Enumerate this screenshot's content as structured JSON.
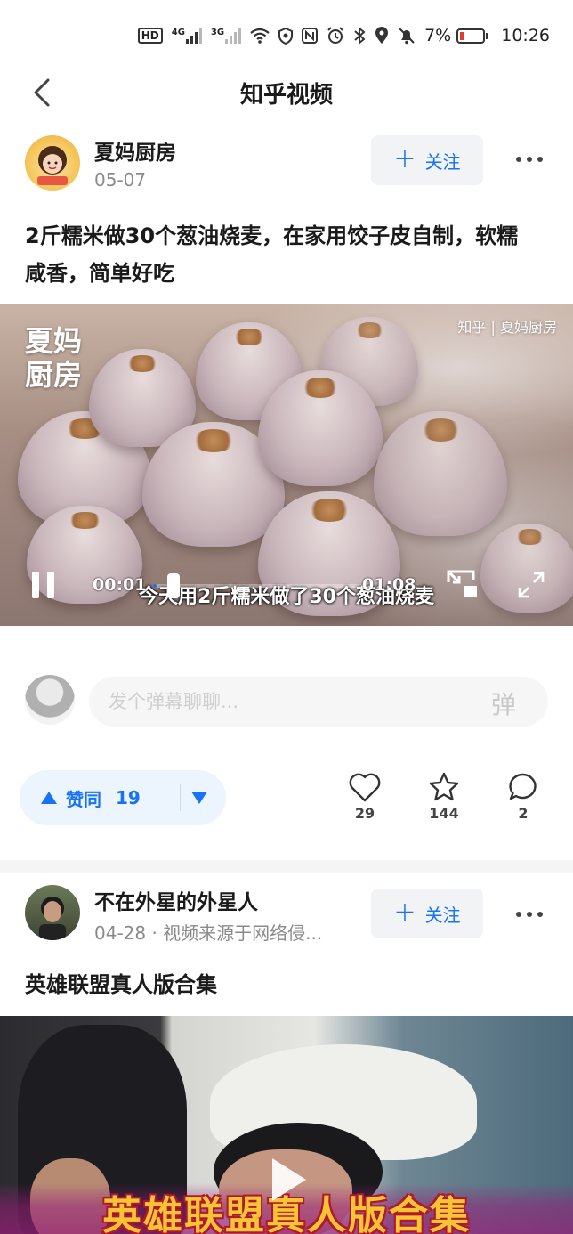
{
  "status_bar": {
    "hd_label": "HD",
    "net1": "4G",
    "net2": "3G",
    "battery_percent": "7%",
    "time": "10:26"
  },
  "nav": {
    "title": "知乎视频"
  },
  "post1": {
    "author": "夏妈厨房",
    "date": "05-07",
    "follow_label": "关注",
    "title": "2斤糯米做30个葱油烧麦，在家用饺子皮自制，软糯咸香，简单好吃",
    "video": {
      "watermark_logo": "夏妈\n厨房",
      "watermark_top_right": "知乎 | 夏妈厨房",
      "subtitle": "今天用2斤糯米做了30个葱油烧麦",
      "current_time": "00:01",
      "duration": "01:08",
      "progress_fraction": 0.015
    }
  },
  "danmaku": {
    "placeholder": "发个弹幕聊聊...",
    "toggle_label": "弹"
  },
  "actions": {
    "upvote_label": "赞同",
    "upvote_count": "19",
    "likes": "29",
    "favorites": "144",
    "comments": "2"
  },
  "post2": {
    "author": "不在外星的外星人",
    "meta": "04-28 · 视频来源于网络侵...",
    "follow_label": "关注",
    "title": "英雄联盟真人版合集",
    "video": {
      "caption": "英雄联盟真人版合集"
    }
  },
  "colors": {
    "accent": "#1772f6",
    "follow_bg": "#f2f3f5",
    "vote_bg": "#ecf4fe",
    "battery_low": "#e53935"
  }
}
